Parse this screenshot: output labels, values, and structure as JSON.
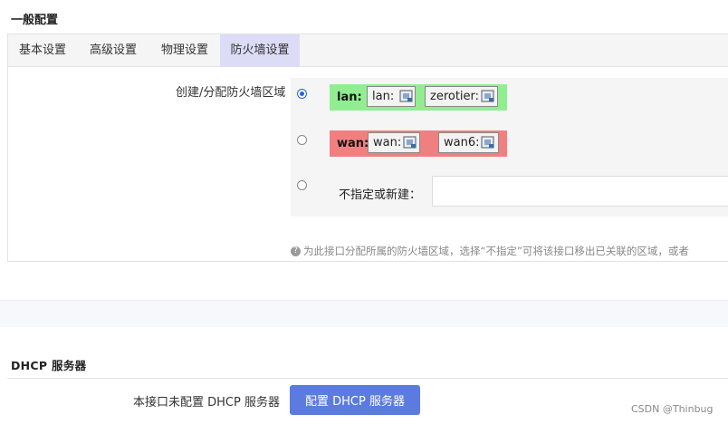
{
  "sections": {
    "general_title": "一般配置",
    "dhcp_title": "DHCP 服务器"
  },
  "tabs": [
    {
      "label": "基本设置",
      "active": false
    },
    {
      "label": "高级设置",
      "active": false
    },
    {
      "label": "物理设置",
      "active": false
    },
    {
      "label": "防火墙设置",
      "active": true
    }
  ],
  "firewall": {
    "field_label": "创建/分配防火墙区域",
    "zones": [
      {
        "name": "lan:",
        "color": "#90ee90",
        "selected": true,
        "interfaces": [
          {
            "label": "lan:",
            "icon": "ethernet-port-icon"
          },
          {
            "label": "zerotier:",
            "icon": "ethernet-port-icon"
          }
        ]
      },
      {
        "name": "wan:",
        "color": "#f08080",
        "selected": false,
        "interfaces": [
          {
            "label": "wan:",
            "icon": "ethernet-port-icon"
          },
          {
            "label": "wan6:",
            "icon": "ethernet-port-icon"
          }
        ]
      }
    ],
    "new_zone_label": "不指定或新建：",
    "new_zone_value": "",
    "help_text": "为此接口分配所属的防火墙区域，选择“不指定”可将该接口移出已关联的区域，或者"
  },
  "dhcp": {
    "status_label": "本接口未配置 DHCP 服务器",
    "button_label": "配置 DHCP 服务器",
    "button_color": "#5b7be0"
  },
  "watermark": "CSDN @Thinbug"
}
